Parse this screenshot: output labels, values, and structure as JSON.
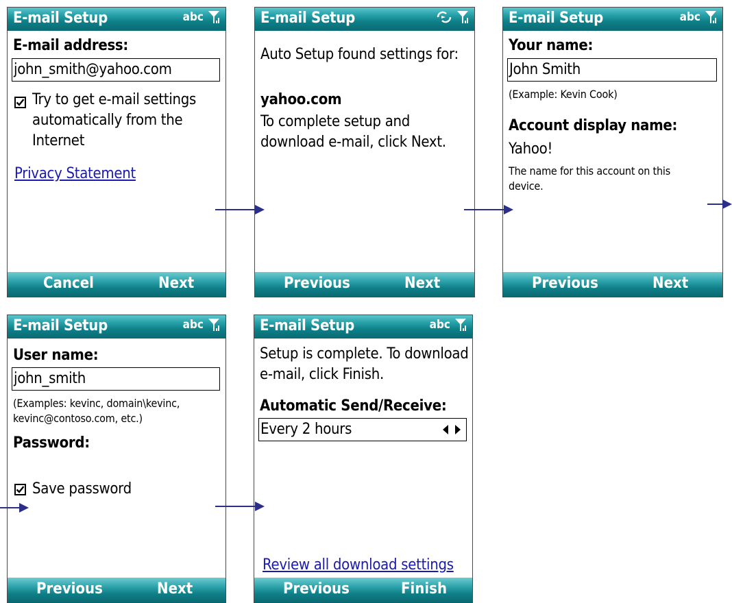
{
  "app_title": "E-mail Setup",
  "status": {
    "input_mode": "abc"
  },
  "screen1": {
    "label": "E-mail address:",
    "email_value": "john_smith@yahoo.com",
    "checkbox_label_lines": [
      "Try to get e-mail settings",
      "automatically from the",
      "Internet"
    ],
    "checkbox_checked": true,
    "link": "Privacy Statement",
    "left_softkey": "Cancel",
    "right_softkey": "Next"
  },
  "screen2": {
    "line1": "Auto Setup found settings for:",
    "domain": "yahoo.com",
    "instructions_lines": [
      "To complete setup and",
      "download e-mail, click Next."
    ],
    "left_softkey": "Previous",
    "right_softkey": "Next"
  },
  "screen3": {
    "name_label": "Your name:",
    "name_value": "John Smith",
    "name_example": "(Example: Kevin Cook)",
    "display_label": "Account display name:",
    "display_value": "Yahoo!",
    "display_help_lines": [
      "The name for this account on this",
      "device."
    ],
    "left_softkey": "Previous",
    "right_softkey": "Next"
  },
  "screen4": {
    "user_label": "User name:",
    "user_value": "john_smith",
    "user_example_lines": [
      "(Examples: kevinc, domain\\kevinc,",
      "kevinc@contoso.com, etc.)"
    ],
    "password_label": "Password:",
    "save_password_label": "Save password",
    "save_password_checked": true,
    "left_softkey": "Previous",
    "right_softkey": "Next"
  },
  "screen5": {
    "complete_lines": [
      "Setup is complete.  To download",
      "e-mail, click Finish."
    ],
    "auto_label": "Automatic Send/Receive:",
    "auto_value": "Every 2 hours",
    "link": "Review all download settings",
    "left_softkey": "Previous",
    "right_softkey": "Finish"
  },
  "colors": {
    "titlebar": "#0e8089",
    "link": "#1a1ab0",
    "arrow": "#2b2f8a"
  }
}
